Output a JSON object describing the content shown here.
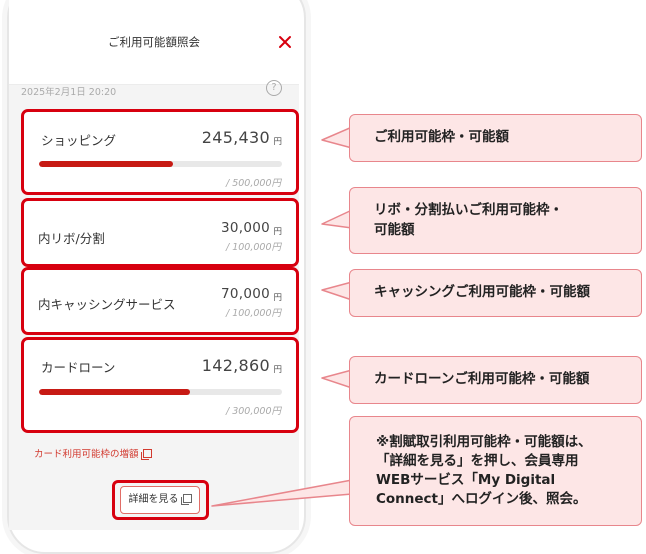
{
  "header": {
    "title": "ご利用可能額照会"
  },
  "datetime": "2025年2月1日 20:20",
  "help_symbol": "?",
  "cards": {
    "shopping": {
      "label": "ショッピング",
      "amount": "245,430",
      "unit": "円",
      "limit": "/ 500,000円",
      "usage_fraction": 0.55
    },
    "revo": {
      "label": "内リボ/分割",
      "amount": "30,000",
      "unit": "円",
      "limit": "/ 100,000円"
    },
    "cashing": {
      "label": "内キャッシングサービス",
      "amount": "70,000",
      "unit": "円",
      "limit": "/ 100,000円"
    },
    "loan": {
      "label": "カードローン",
      "amount": "142,860",
      "unit": "円",
      "limit": "/ 300,000円",
      "usage_fraction": 0.62
    }
  },
  "increase_link": "カード利用可能枠の増額",
  "detail_button": "詳細を見る",
  "callouts": {
    "c1": "ご利用可能枠・可能額",
    "c2_l1": "リボ・分割払いご利用可能枠・",
    "c2_l2": "可能額",
    "c3": "キャッシングご利用可能枠・可能額",
    "c4": "カードローンご利用可能枠・可能額",
    "c5_l1": "※割賦取引利用可能枠・可能額は、",
    "c5_l2": "「詳細を見る」を押し、会員専用",
    "c5_l3": "WEBサービス「My Digital",
    "c5_l4": "Connect」へログイン後、照会。"
  },
  "colors": {
    "accent": "#d7000f",
    "bar_fill": "#c71a14",
    "callout_bg": "#fde6e6",
    "callout_border": "#e8868c"
  },
  "icons": {
    "close": "close-icon",
    "help": "help-icon",
    "copy": "copy-icon"
  }
}
